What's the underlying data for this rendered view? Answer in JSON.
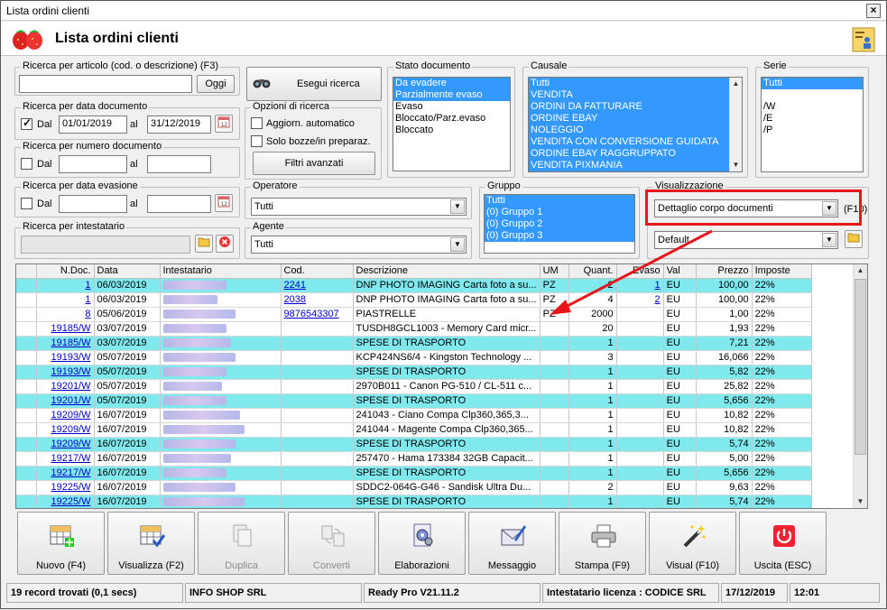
{
  "window": {
    "title": "Lista ordini clienti",
    "header_title": "Lista ordini clienti"
  },
  "search_article": {
    "label": "Ricerca per articolo (cod. o descrizione) (F3)",
    "value": "",
    "button": "Oggi"
  },
  "search_button": "Esegui ricerca",
  "search_doc_date": {
    "label": "Ricerca per data documento",
    "checked": true,
    "dal_label": "Dal",
    "from": "01/01/2019",
    "al_label": "al",
    "to": "31/12/2019"
  },
  "search_doc_number": {
    "label": "Ricerca per numero documento",
    "dal_label": "Dal",
    "al_label": "al"
  },
  "search_evasion_date": {
    "label": "Ricerca per data evasione",
    "dal_label": "Dal",
    "al_label": "al"
  },
  "search_holder": {
    "label": "Ricerca per intestatario"
  },
  "search_options": {
    "label": "Opzioni di ricerca",
    "opt1": "Aggiorn. automatico",
    "opt2": "Solo bozze/in preparaz.",
    "button": "Filtri avanzati"
  },
  "operator": {
    "label": "Operatore",
    "value": "Tutti"
  },
  "agent": {
    "label": "Agente",
    "value": "Tutti"
  },
  "doc_state": {
    "label": "Stato documento",
    "items": [
      "Da evadere",
      "Parzialmente evaso",
      "Evaso",
      "Bloccato/Parz.evaso",
      "Bloccato"
    ],
    "selected": [
      0,
      1
    ]
  },
  "causale": {
    "label": "Causale",
    "items": [
      "Tutti",
      "VENDITA",
      "ORDINI DA FATTURARE",
      "ORDINE EBAY",
      "NOLEGGIO",
      "VENDITA CON CONVERSIONE GUIDATA",
      "ORDINE EBAY RAGGRUPPATO",
      "VENDITA PIXMANIA"
    ]
  },
  "serie": {
    "label": "Serie",
    "items": [
      "Tutti",
      "",
      "/W",
      "/E",
      "/P"
    ]
  },
  "gruppo": {
    "label": "Gruppo",
    "items": [
      "Tutti",
      "(0) Gruppo 1",
      "(0) Gruppo 2",
      "(0) Gruppo 3"
    ]
  },
  "visualizzazione": {
    "label": "Visualizzazione",
    "value": "Dettaglio corpo documenti",
    "shortcut": "(F10)",
    "value2": "Default"
  },
  "grid": {
    "columns": [
      "N.Doc.",
      "Data",
      "Intestatario",
      "Cod.",
      "Descrizione",
      "UM",
      "Quant.",
      "Evaso",
      "Val",
      "Prezzo",
      "Imposte"
    ],
    "rows": [
      {
        "ndoc": "1",
        "data": "06/03/2019",
        "cod": "2241",
        "desc": "DNP PHOTO IMAGING Carta foto a su...",
        "um": "PZ",
        "q": "2",
        "ev": "1",
        "val": "EU",
        "prezzo": "100,00",
        "imp": "22%",
        "cyan": true
      },
      {
        "ndoc": "1",
        "data": "06/03/2019",
        "cod": "2038",
        "desc": "DNP PHOTO IMAGING Carta foto a su...",
        "um": "PZ",
        "q": "4",
        "ev": "2",
        "val": "EU",
        "prezzo": "100,00",
        "imp": "22%",
        "cyan": false
      },
      {
        "ndoc": "8",
        "data": "05/06/2019",
        "cod": "9876543307",
        "desc": "PIASTRELLE",
        "um": "PZ",
        "q": "2000",
        "ev": "",
        "val": "EU",
        "prezzo": "1,00",
        "imp": "22%",
        "cyan": false
      },
      {
        "ndoc": "19185/W",
        "data": "03/07/2019",
        "cod": "",
        "desc": "TUSDH8GCL1003 - Memory Card micr...",
        "um": "",
        "q": "20",
        "ev": "",
        "val": "EU",
        "prezzo": "1,93",
        "imp": "22%",
        "cyan": false
      },
      {
        "ndoc": "19185/W",
        "data": "03/07/2019",
        "cod": "",
        "desc": "SPESE DI TRASPORTO",
        "um": "",
        "q": "1",
        "ev": "",
        "val": "EU",
        "prezzo": "7,21",
        "imp": "22%",
        "cyan": true
      },
      {
        "ndoc": "19193/W",
        "data": "05/07/2019",
        "cod": "",
        "desc": "KCP424NS6/4 - Kingston Technology ...",
        "um": "",
        "q": "3",
        "ev": "",
        "val": "EU",
        "prezzo": "16,066",
        "imp": "22%",
        "cyan": false
      },
      {
        "ndoc": "19193/W",
        "data": "05/07/2019",
        "cod": "",
        "desc": "SPESE DI TRASPORTO",
        "um": "",
        "q": "1",
        "ev": "",
        "val": "EU",
        "prezzo": "5,82",
        "imp": "22%",
        "cyan": true
      },
      {
        "ndoc": "19201/W",
        "data": "05/07/2019",
        "cod": "",
        "desc": "2970B011 - Canon PG-510 / CL-511 c...",
        "um": "",
        "q": "1",
        "ev": "",
        "val": "EU",
        "prezzo": "25,82",
        "imp": "22%",
        "cyan": false
      },
      {
        "ndoc": "19201/W",
        "data": "05/07/2019",
        "cod": "",
        "desc": "SPESE DI TRASPORTO",
        "um": "",
        "q": "1",
        "ev": "",
        "val": "EU",
        "prezzo": "5,656",
        "imp": "22%",
        "cyan": true
      },
      {
        "ndoc": "19209/W",
        "data": "16/07/2019",
        "cod": "",
        "desc": "241043 - Ciano Compa Clp360,365,3...",
        "um": "",
        "q": "1",
        "ev": "",
        "val": "EU",
        "prezzo": "10,82",
        "imp": "22%",
        "cyan": false
      },
      {
        "ndoc": "19209/W",
        "data": "16/07/2019",
        "cod": "",
        "desc": "241044 - Magente Compa Clp360,365...",
        "um": "",
        "q": "1",
        "ev": "",
        "val": "EU",
        "prezzo": "10,82",
        "imp": "22%",
        "cyan": false
      },
      {
        "ndoc": "19209/W",
        "data": "16/07/2019",
        "cod": "",
        "desc": "SPESE DI TRASPORTO",
        "um": "",
        "q": "1",
        "ev": "",
        "val": "EU",
        "prezzo": "5,74",
        "imp": "22%",
        "cyan": true
      },
      {
        "ndoc": "19217/W",
        "data": "16/07/2019",
        "cod": "",
        "desc": "257470 - Hama 173384 32GB Capacit...",
        "um": "",
        "q": "1",
        "ev": "",
        "val": "EU",
        "prezzo": "5,00",
        "imp": "22%",
        "cyan": false
      },
      {
        "ndoc": "19217/W",
        "data": "16/07/2019",
        "cod": "",
        "desc": "SPESE DI TRASPORTO",
        "um": "",
        "q": "1",
        "ev": "",
        "val": "EU",
        "prezzo": "5,656",
        "imp": "22%",
        "cyan": true
      },
      {
        "ndoc": "19225/W",
        "data": "16/07/2019",
        "cod": "",
        "desc": "SDDC2-064G-G46 - Sandisk Ultra Du...",
        "um": "",
        "q": "2",
        "ev": "",
        "val": "EU",
        "prezzo": "9,63",
        "imp": "22%",
        "cyan": false
      },
      {
        "ndoc": "19225/W",
        "data": "16/07/2019",
        "cod": "",
        "desc": "SPESE DI TRASPORTO",
        "um": "",
        "q": "1",
        "ev": "",
        "val": "EU",
        "prezzo": "5,74",
        "imp": "22%",
        "cyan": true
      }
    ]
  },
  "toolbar": {
    "nuovo": "Nuovo (F4)",
    "visualizza": "Visualizza (F2)",
    "duplica": "Duplica",
    "converti": "Converti",
    "elaborazioni": "Elaborazioni",
    "messaggio": "Messaggio",
    "stampa": "Stampa (F9)",
    "visual": "Visual (F10)",
    "uscita": "Uscita (ESC)"
  },
  "status": {
    "records": "19 record trovati (0,1 secs)",
    "company": "INFO SHOP SRL",
    "version": "Ready Pro V21.11.2",
    "license": "Intestatario licenza : CODICE SRL",
    "date": "17/12/2019",
    "time": "12:01"
  },
  "colors": {
    "selection": "#3399ff",
    "cyan_row": "#7fe9ee",
    "annotation": "#e8161b"
  }
}
